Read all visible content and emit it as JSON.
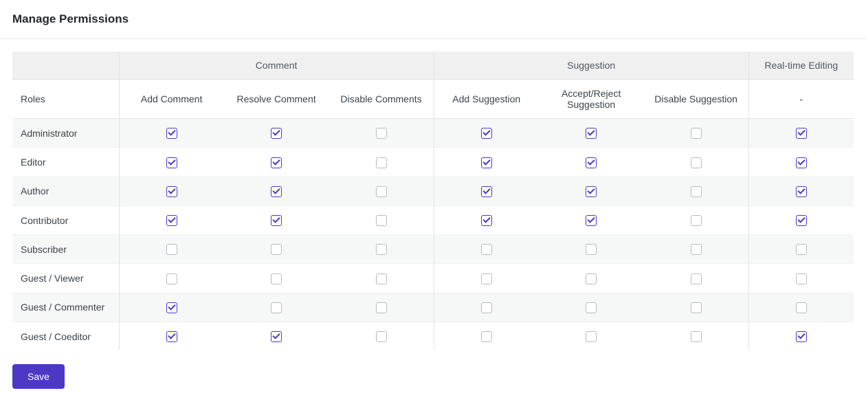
{
  "page_title": "Manage Permissions",
  "groups": {
    "comment": "Comment",
    "suggestion": "Suggestion",
    "realtime": "Real-time Editing"
  },
  "columns": {
    "roles": "Roles",
    "add_comment": "Add Comment",
    "resolve_comment": "Resolve Comment",
    "disable_comments": "Disable Comments",
    "add_suggestion": "Add Suggestion",
    "accept_reject_suggestion": "Accept/Reject Suggestion",
    "disable_suggestion": "Disable Suggestion",
    "realtime_sub": "-"
  },
  "roles": [
    {
      "name": "Administrator",
      "perms": [
        true,
        true,
        false,
        true,
        true,
        false,
        true
      ]
    },
    {
      "name": "Editor",
      "perms": [
        true,
        true,
        false,
        true,
        true,
        false,
        true
      ]
    },
    {
      "name": "Author",
      "perms": [
        true,
        true,
        false,
        true,
        true,
        false,
        true
      ]
    },
    {
      "name": "Contributor",
      "perms": [
        true,
        true,
        false,
        true,
        true,
        false,
        true
      ]
    },
    {
      "name": "Subscriber",
      "perms": [
        false,
        false,
        false,
        false,
        false,
        false,
        false
      ]
    },
    {
      "name": "Guest / Viewer",
      "perms": [
        false,
        false,
        false,
        false,
        false,
        false,
        false
      ]
    },
    {
      "name": "Guest / Commenter",
      "perms": [
        true,
        false,
        false,
        false,
        false,
        false,
        false
      ]
    },
    {
      "name": "Guest / Coeditor",
      "perms": [
        true,
        true,
        false,
        false,
        false,
        false,
        true
      ]
    }
  ],
  "save_label": "Save"
}
